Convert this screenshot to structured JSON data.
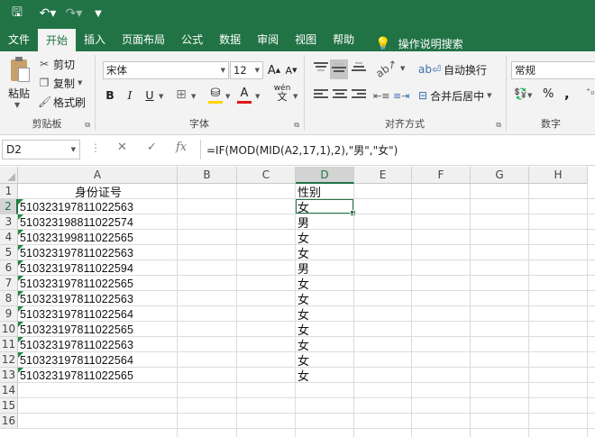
{
  "ribbon_tabs": [
    "文件",
    "开始",
    "插入",
    "页面布局",
    "公式",
    "数据",
    "审阅",
    "视图",
    "帮助"
  ],
  "active_tab": "开始",
  "tell_me": "操作说明搜索",
  "clipboard": {
    "paste": "粘贴",
    "cut": "剪切",
    "copy": "复制",
    "format_painter": "格式刷",
    "group": "剪贴板"
  },
  "font": {
    "name": "宋体",
    "size": "12",
    "group": "字体",
    "bold": "B",
    "italic": "I",
    "underline": "U",
    "grow": "A",
    "shrink": "A",
    "font_color": "A",
    "phonetic": "wén",
    "fill_color_hex": "#ffd500",
    "font_color_hex": "#e01515"
  },
  "alignment": {
    "wrap_text": "自动换行",
    "merge_center": "合并后居中",
    "group": "对齐方式"
  },
  "number": {
    "format": "常规",
    "percent": "%",
    "comma": ",",
    "group": "数字"
  },
  "formula_bar": {
    "name_box": "D2",
    "formula": "=IF(MOD(MID(A2,17,1),2),\"男\",\"女\")",
    "cancel": "✕",
    "enter": "✓",
    "fx": "fx"
  },
  "sheet": {
    "columns": [
      "A",
      "B",
      "C",
      "D",
      "E",
      "F",
      "G",
      "H"
    ],
    "selected_column": "D",
    "selected_row": 2,
    "row_numbers": [
      "1",
      "2",
      "3",
      "4",
      "5",
      "6",
      "7",
      "8",
      "9",
      "10",
      "11",
      "12",
      "13",
      "14",
      "15",
      "16"
    ],
    "header_row": {
      "A": "身份证号",
      "D": "性别"
    },
    "rows": [
      {
        "id": "510323197811022563",
        "gender": "女"
      },
      {
        "id": "510323198811022574",
        "gender": "男"
      },
      {
        "id": "510323199811022565",
        "gender": "女"
      },
      {
        "id": "510323197811022563",
        "gender": "女"
      },
      {
        "id": "510323197811022594",
        "gender": "男"
      },
      {
        "id": "510323197811022565",
        "gender": "女"
      },
      {
        "id": "510323197811022563",
        "gender": "女"
      },
      {
        "id": "510323197811022564",
        "gender": "女"
      },
      {
        "id": "510323197811022565",
        "gender": "女"
      },
      {
        "id": "510323197811022563",
        "gender": "女"
      },
      {
        "id": "510323197811022564",
        "gender": "女"
      },
      {
        "id": "510323197811022565",
        "gender": "女"
      }
    ]
  }
}
